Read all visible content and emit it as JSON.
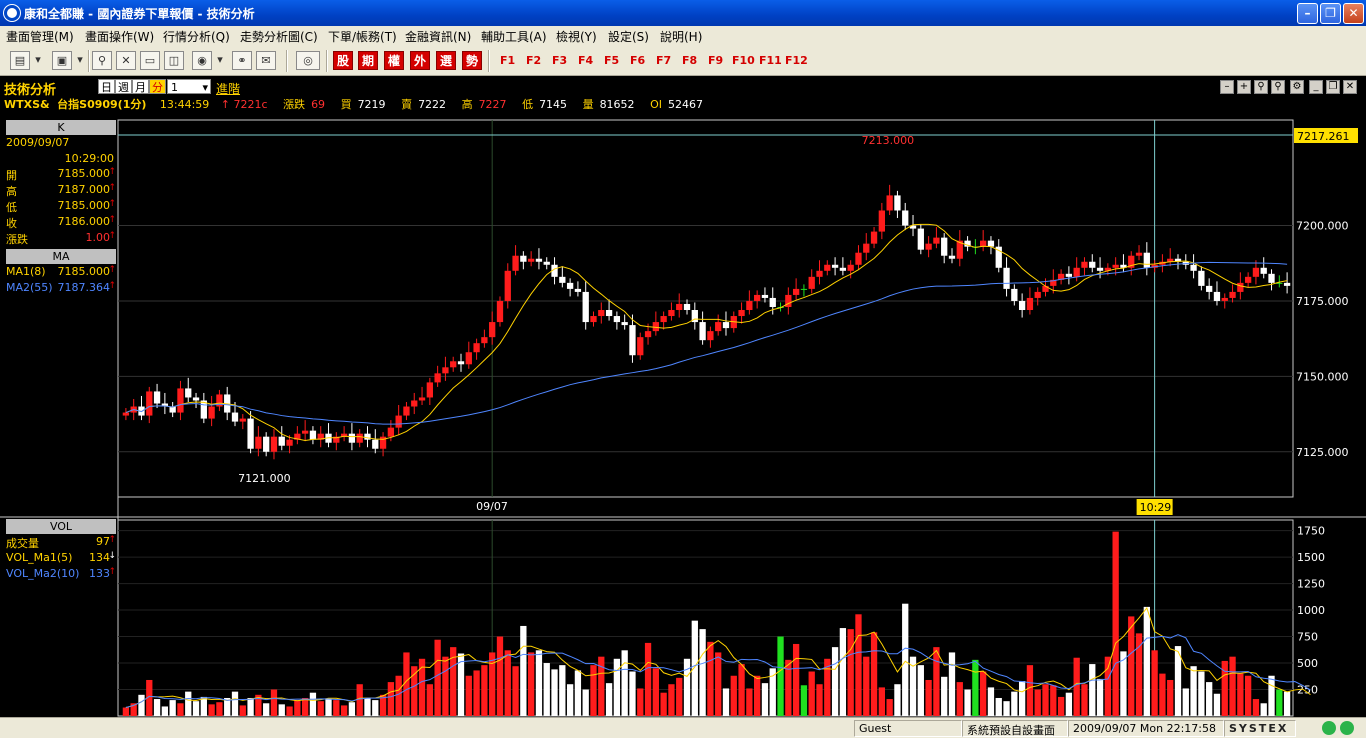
{
  "window": {
    "title": "康和全都賺 - 國內證券下單報價 - 技術分析"
  },
  "menu": [
    "畫面管理(M)",
    "畫面操作(W)",
    "行情分析(Q)",
    "走勢分析圖(C)",
    "下單/帳務(T)",
    "金融資訊(N)",
    "輔助工具(A)",
    "檢視(Y)",
    "設定(S)",
    "說明(H)"
  ],
  "toolbar": {
    "category_buttons": [
      "股",
      "期",
      "權",
      "外",
      "選",
      "勢"
    ],
    "function_keys": [
      "F1",
      "F2",
      "F3",
      "F4",
      "F5",
      "F6",
      "F7",
      "F8",
      "F9",
      "F10",
      "F11",
      "F12"
    ]
  },
  "panel": {
    "title": "技術分析",
    "periods": [
      "日",
      "週",
      "月",
      "分"
    ],
    "interval": "1",
    "advanced": "進階",
    "quote": {
      "symbol": "WTXS&",
      "name": "台指S0909(1分)",
      "time": "13:44:59",
      "last": "7221c",
      "change_label": "漲跌",
      "change": "69",
      "bid_label": "買",
      "bid": "7219",
      "ask_label": "賣",
      "ask": "7222",
      "high_label": "高",
      "high": "7227",
      "low_label": "低",
      "low": "7145",
      "vol_label": "量",
      "vol": "81652",
      "oi_label": "OI",
      "oi": "52467"
    }
  },
  "kpanel": {
    "header": "K",
    "date": "2009/09/07",
    "time": "10:29:00",
    "rows": [
      {
        "label": "開",
        "value": "7185.000"
      },
      {
        "label": "高",
        "value": "7187.000"
      },
      {
        "label": "低",
        "value": "7185.000"
      },
      {
        "label": "收",
        "value": "7186.000"
      },
      {
        "label": "漲跌",
        "value": "1.00"
      }
    ],
    "ma_header": "MA",
    "ma": [
      {
        "label": "MA1(8)",
        "value": "7185.000",
        "color": "#ffd200"
      },
      {
        "label": "MA2(55)",
        "value": "7187.364",
        "color": "#4f86ff"
      }
    ]
  },
  "volpanel": {
    "header": "VOL",
    "rows": [
      {
        "label": "成交量",
        "value": "97",
        "color": "#ffd200"
      },
      {
        "label": "VOL_Ma1(5)",
        "value": "134",
        "color": "#ffd200"
      },
      {
        "label": "VOL_Ma2(10)",
        "value": "133",
        "color": "#4f86ff"
      }
    ]
  },
  "chart_data": {
    "type": "candlestick",
    "price_axis": {
      "ticks": [
        "7125.000",
        "7150.000",
        "7175.000",
        "7200.000"
      ],
      "ylim": [
        7110,
        7235
      ],
      "current_label": "7217.261"
    },
    "vol_axis": {
      "ticks": [
        "250",
        "500",
        "750",
        "1000",
        "1250",
        "1500",
        "1750"
      ],
      "ylim": [
        0,
        1850
      ]
    },
    "annotations": {
      "high": "7213.000",
      "low": "7121.000",
      "date_label": "09/07",
      "cursor_time": "10:29"
    },
    "colors": {
      "up": "#ff1c1c",
      "down": "#ffffff",
      "flat": "#20e020",
      "ma1": "#ffd200",
      "ma2": "#4f86ff"
    },
    "closes": [
      7138,
      7140,
      7137,
      7145,
      7141,
      7140,
      7138,
      7146,
      7143,
      7142,
      7136,
      7140,
      7144,
      7138,
      7135,
      7136,
      7126,
      7130,
      7125,
      7130,
      7127,
      7129,
      7131,
      7132,
      7129,
      7131,
      7128,
      7130,
      7131,
      7128,
      7131,
      7129,
      7126,
      7130,
      7133,
      7137,
      7140,
      7142,
      7143,
      7148,
      7151,
      7153,
      7155,
      7154,
      7158,
      7161,
      7163,
      7168,
      7175,
      7185,
      7190,
      7188,
      7189,
      7188,
      7187,
      7183,
      7181,
      7179,
      7178,
      7168,
      7170,
      7172,
      7170,
      7168,
      7167,
      7157,
      7163,
      7165,
      7168,
      7170,
      7172,
      7174,
      7172,
      7168,
      7162,
      7165,
      7168,
      7166,
      7170,
      7172,
      7175,
      7177,
      7176,
      7173,
      7173,
      7177,
      7179,
      7179,
      7183,
      7185,
      7187,
      7186,
      7185,
      7187,
      7191,
      7194,
      7198,
      7205,
      7210,
      7205,
      7200,
      7199,
      7192,
      7194,
      7196,
      7190,
      7189,
      7195,
      7193,
      7193,
      7195,
      7193,
      7186,
      7179,
      7175,
      7172,
      7176,
      7178,
      7180,
      7182,
      7184,
      7183,
      7186,
      7188,
      7186,
      7185,
      7186,
      7187,
      7186,
      7190,
      7191,
      7186,
      7187,
      7188,
      7189,
      7188,
      7187,
      7185,
      7180,
      7178,
      7175,
      7176,
      7178,
      7181,
      7183,
      7186,
      7184,
      7181,
      7181,
      7180
    ],
    "volumes": [
      80,
      120,
      200,
      340,
      160,
      90,
      150,
      120,
      230,
      140,
      180,
      110,
      130,
      170,
      230,
      100,
      170,
      200,
      120,
      250,
      110,
      90,
      150,
      170,
      220,
      140,
      160,
      150,
      100,
      130,
      300,
      170,
      150,
      200,
      320,
      380,
      600,
      470,
      540,
      300,
      720,
      560,
      650,
      590,
      380,
      430,
      480,
      600,
      750,
      620,
      470,
      850,
      600,
      620,
      500,
      440,
      480,
      300,
      430,
      250,
      480,
      560,
      310,
      540,
      620,
      420,
      260,
      690,
      450,
      220,
      300,
      360,
      540,
      900,
      820,
      700,
      600,
      260,
      380,
      490,
      260,
      380,
      310,
      450,
      750,
      530,
      680,
      290,
      420,
      300,
      540,
      650,
      830,
      820,
      960,
      560,
      790,
      270,
      160,
      300,
      1060,
      560,
      480,
      340,
      650,
      370,
      600,
      320,
      250,
      530,
      420,
      270,
      170,
      140,
      230,
      330,
      480,
      250,
      300,
      290,
      180,
      220,
      550,
      300,
      490,
      350,
      560,
      1740,
      610,
      940,
      780,
      1030,
      620,
      400,
      340,
      660,
      260,
      470,
      420,
      320,
      210,
      520,
      560,
      400,
      380,
      160,
      120,
      380,
      250,
      230,
      250,
      160,
      120
    ]
  },
  "status": {
    "user": "Guest",
    "screen": "系統預設自設畫面",
    "datetime": "2009/09/07 Mon 22:17:58",
    "brand": "SYSTEX"
  }
}
